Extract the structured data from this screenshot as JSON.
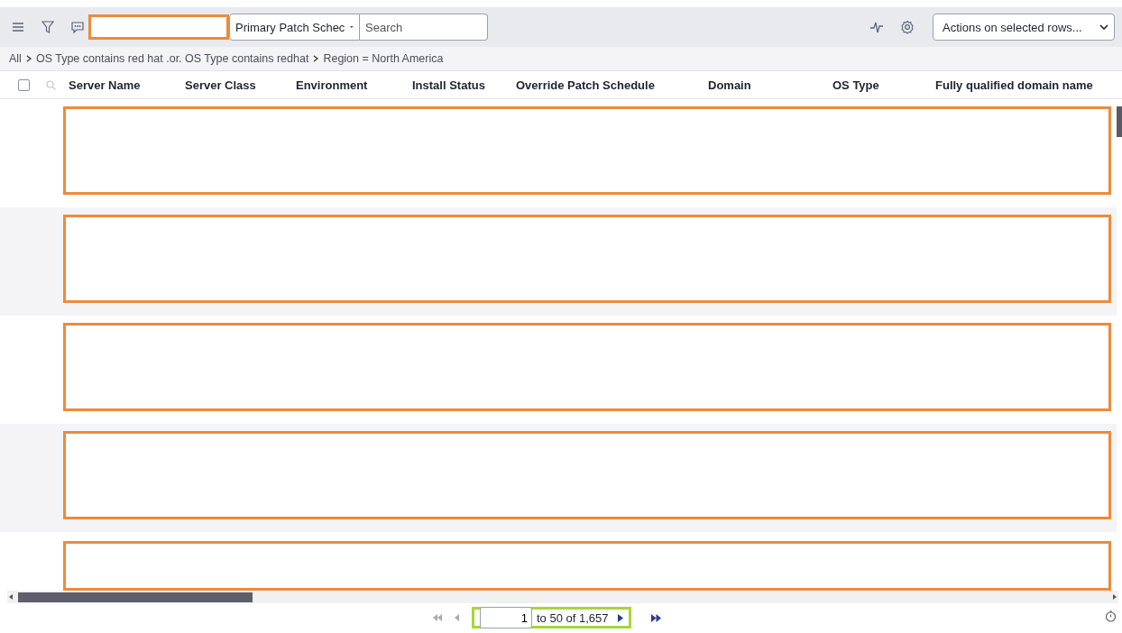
{
  "toolbar": {
    "redacted_field": {
      "kind": "redacted"
    },
    "view_select": {
      "value": "Primary Patch Schec"
    },
    "search": {
      "placeholder": "Search"
    },
    "actions_select": {
      "value": "Actions on selected rows..."
    }
  },
  "breadcrumb": [
    {
      "label": "All"
    },
    {
      "label": "OS Type contains red hat .or. OS Type contains redhat"
    },
    {
      "label": "Region = North America"
    }
  ],
  "table": {
    "select_all_checked": false,
    "columns": [
      "Server Name",
      "Server Class",
      "Environment",
      "Install Status",
      "Override Patch Schedule",
      "Domain",
      "OS Type",
      "Fully qualified domain name"
    ],
    "rows": [
      {
        "kind": "redacted"
      },
      {
        "kind": "redacted"
      },
      {
        "kind": "redacted"
      },
      {
        "kind": "redacted"
      },
      {
        "kind": "redacted"
      }
    ]
  },
  "pagination": {
    "page_input": "1",
    "range": "to 50 of 1,657",
    "highlighted": true
  }
}
